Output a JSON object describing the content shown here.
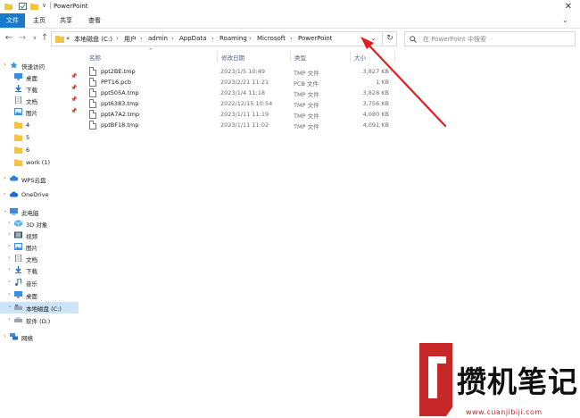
{
  "window": {
    "title": "PowerPoint"
  },
  "ribbon": {
    "tabs": [
      "文件",
      "主页",
      "共享",
      "查看"
    ]
  },
  "breadcrumb": {
    "prefix": "«",
    "items": [
      "本地磁盘 (C:)",
      "用户",
      "admin",
      "AppData",
      "Roaming",
      "Microsoft",
      "PowerPoint"
    ]
  },
  "search": {
    "placeholder": "在 PowerPoint 中搜索"
  },
  "sidebar": {
    "items": [
      {
        "label": "快速访问",
        "icon": "star-icon"
      },
      {
        "label": "桌面",
        "icon": "desktop-icon",
        "pinned": true
      },
      {
        "label": "下载",
        "icon": "download-icon",
        "pinned": true
      },
      {
        "label": "文档",
        "icon": "document-icon",
        "pinned": true
      },
      {
        "label": "图片",
        "icon": "picture-icon",
        "pinned": true
      },
      {
        "label": "4",
        "icon": "folder-icon"
      },
      {
        "label": "5",
        "icon": "folder-icon"
      },
      {
        "label": "6",
        "icon": "folder-icon"
      },
      {
        "label": "work (1)",
        "icon": "folder-icon"
      },
      {
        "label": "WPS云盘",
        "icon": "cloud-icon"
      },
      {
        "label": "OneDrive",
        "icon": "cloud-icon"
      },
      {
        "label": "此电脑",
        "icon": "computer-icon"
      },
      {
        "label": "3D 对象",
        "icon": "cube-icon"
      },
      {
        "label": "视频",
        "icon": "video-icon"
      },
      {
        "label": "图片",
        "icon": "picture-icon"
      },
      {
        "label": "文档",
        "icon": "document-icon"
      },
      {
        "label": "下载",
        "icon": "download-icon"
      },
      {
        "label": "音乐",
        "icon": "music-icon"
      },
      {
        "label": "桌面",
        "icon": "desktop-icon"
      },
      {
        "label": "本地磁盘 (C:)",
        "icon": "drive-icon"
      },
      {
        "label": "软件 (D:)",
        "icon": "drive-icon"
      },
      {
        "label": "网络",
        "icon": "network-icon"
      }
    ]
  },
  "columns": {
    "name": "名称",
    "date": "修改日期",
    "type": "类型",
    "size": "大小"
  },
  "files": [
    {
      "name": "ppt2BE.tmp",
      "date": "2023/1/5 10:49",
      "type": "TMP 文件",
      "size": "3,827 KB"
    },
    {
      "name": "PPT16.pcb",
      "date": "2023/2/21 11:21",
      "type": "PCB 文件",
      "size": "1 KB"
    },
    {
      "name": "ppt505A.tmp",
      "date": "2023/1/4 11:18",
      "type": "TMP 文件",
      "size": "3,828 KB"
    },
    {
      "name": "ppt6383.tmp",
      "date": "2022/12/15 10:54",
      "type": "TMP 文件",
      "size": "3,756 KB"
    },
    {
      "name": "pptA7A2.tmp",
      "date": "2023/1/11 11:19",
      "type": "TMP 文件",
      "size": "4,080 KB"
    },
    {
      "name": "pptBF18.tmp",
      "date": "2023/1/11 11:02",
      "type": "TMP 文件",
      "size": "4,091 KB"
    }
  ],
  "watermark": {
    "text": "攒机笔记",
    "url": "www.cuanjibiji.com"
  },
  "colors": {
    "accent": "#1979ca",
    "selection": "#cce4f7",
    "folder": "#f5c342",
    "annotation": "#e02020",
    "watermark_red": "#c62828"
  }
}
